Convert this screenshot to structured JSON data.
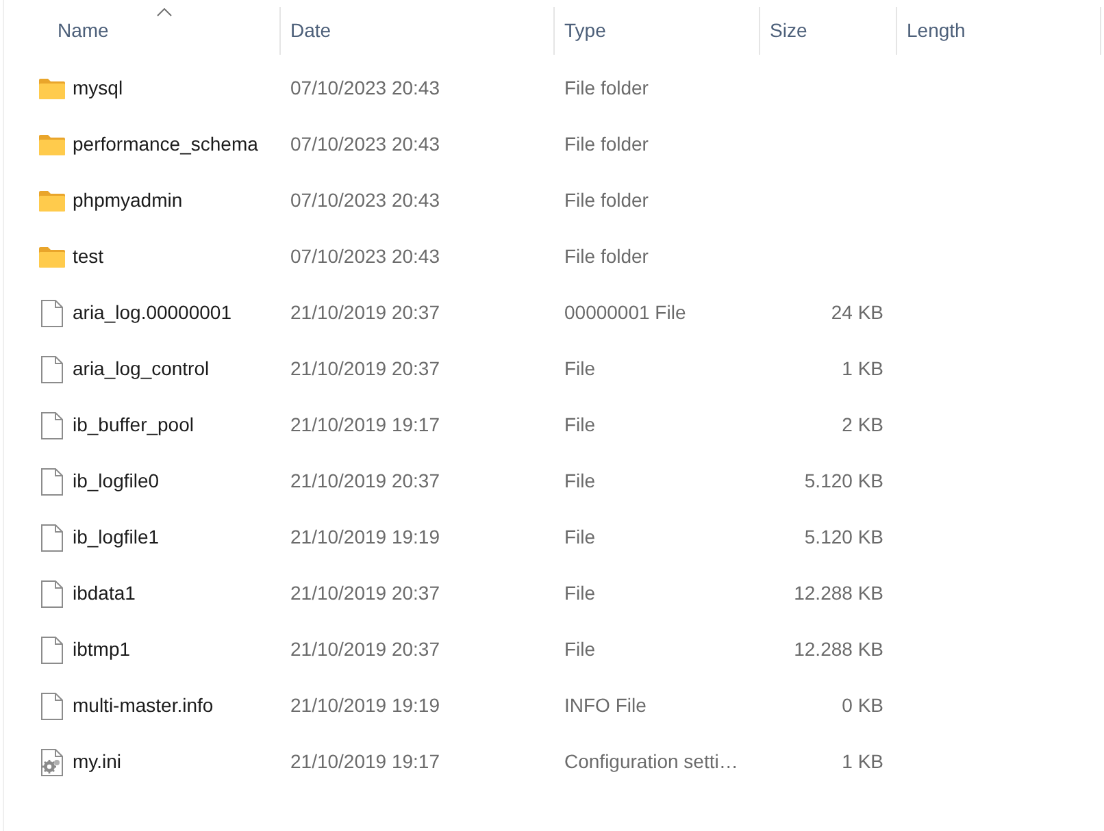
{
  "columns": [
    {
      "label": "Name",
      "sorted": true
    },
    {
      "label": "Date",
      "sorted": false
    },
    {
      "label": "Type",
      "sorted": false
    },
    {
      "label": "Size",
      "sorted": false
    },
    {
      "label": "Length",
      "sorted": false
    }
  ],
  "rows": [
    {
      "kind": "folder",
      "name": "mysql",
      "date": "07/10/2023 20:43",
      "type": "File folder"
    },
    {
      "kind": "folder",
      "name": "performance_schema",
      "date": "07/10/2023 20:43",
      "type": "File folder"
    },
    {
      "kind": "folder",
      "name": "phpmyadmin",
      "date": "07/10/2023 20:43",
      "type": "File folder"
    },
    {
      "kind": "folder",
      "name": "test",
      "date": "07/10/2023 20:43",
      "type": "File folder"
    },
    {
      "kind": "file",
      "name": "aria_log.00000001",
      "date": "21/10/2019 20:37",
      "type": "00000001 File",
      "size": "24 KB"
    },
    {
      "kind": "file",
      "name": "aria_log_control",
      "date": "21/10/2019 20:37",
      "type": "File",
      "size": "1 KB"
    },
    {
      "kind": "file",
      "name": "ib_buffer_pool",
      "date": "21/10/2019 19:17",
      "type": "File",
      "size": "2 KB"
    },
    {
      "kind": "file",
      "name": "ib_logfile0",
      "date": "21/10/2019 20:37",
      "type": "File",
      "size": "5.120 KB"
    },
    {
      "kind": "file",
      "name": "ib_logfile1",
      "date": "21/10/2019 19:19",
      "type": "File",
      "size": "5.120 KB"
    },
    {
      "kind": "file",
      "name": "ibdata1",
      "date": "21/10/2019 20:37",
      "type": "File",
      "size": "12.288 KB"
    },
    {
      "kind": "file",
      "name": "ibtmp1",
      "date": "21/10/2019 20:37",
      "type": "File",
      "size": "12.288 KB"
    },
    {
      "kind": "file",
      "name": "multi-master.info",
      "date": "21/10/2019 19:19",
      "type": "INFO File",
      "size": "0 KB"
    },
    {
      "kind": "settings",
      "name": "my.ini",
      "date": "21/10/2019 19:17",
      "type": "Configuration setti…",
      "size": "1 KB"
    }
  ]
}
